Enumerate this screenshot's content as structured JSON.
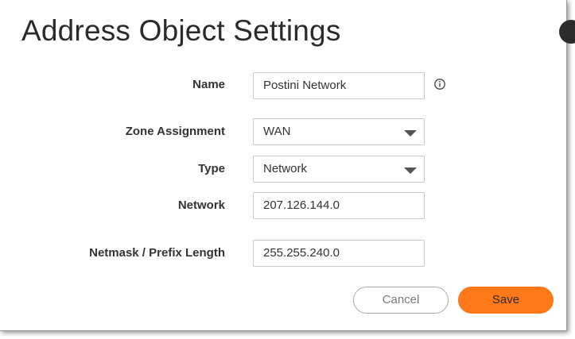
{
  "dialog": {
    "title": "Address Object Settings"
  },
  "form": {
    "name": {
      "label": "Name",
      "value": "Postini Network",
      "info_icon": "info-icon"
    },
    "zone": {
      "label": "Zone Assignment",
      "value": "WAN",
      "icon": "caret-down-icon"
    },
    "type": {
      "label": "Type",
      "value": "Network",
      "icon": "caret-down-icon"
    },
    "network": {
      "label": "Network",
      "value": "207.126.144.0"
    },
    "netmask": {
      "label": "Netmask / Prefix Length",
      "value": "255.255.240.0"
    }
  },
  "buttons": {
    "cancel_label": "Cancel",
    "save_label": "Save"
  },
  "colors": {
    "accent": "#ff791a",
    "text": "#333333",
    "border": "#c9c9c9"
  }
}
